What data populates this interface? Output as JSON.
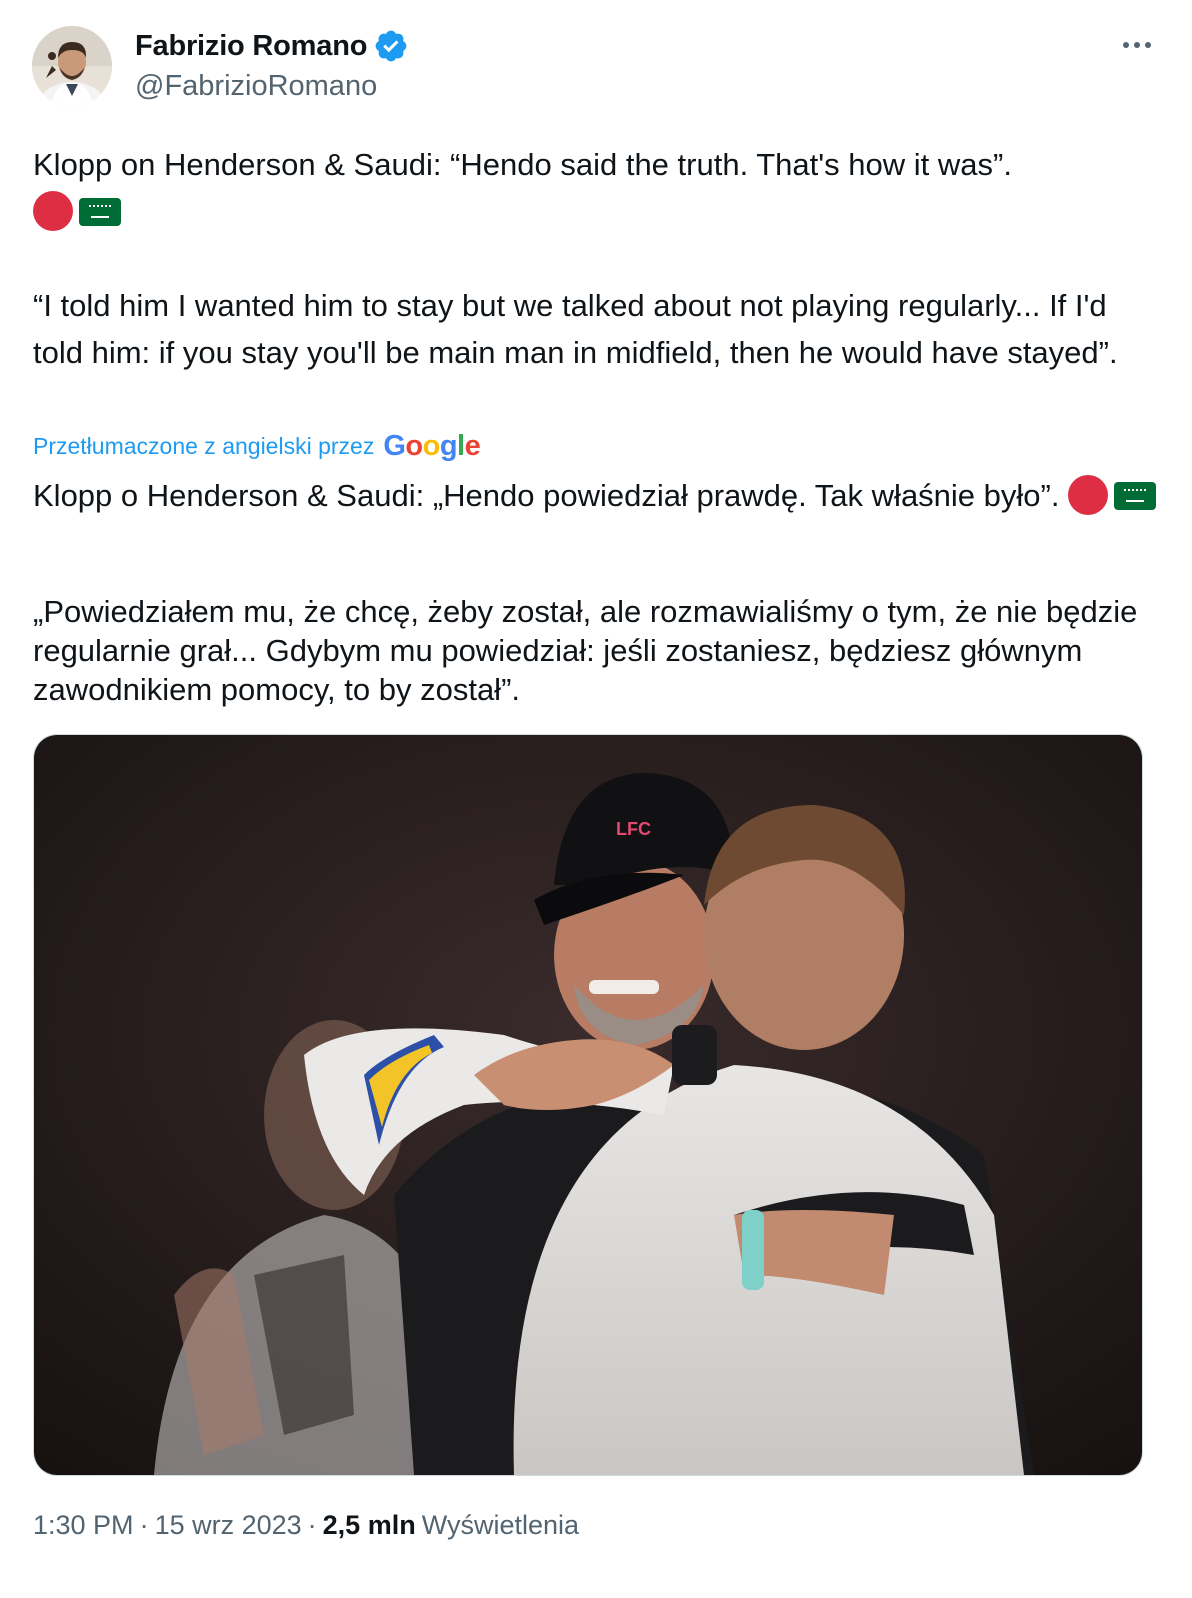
{
  "author": {
    "name": "Fabrizio Romano",
    "handle": "@FabrizioRomano",
    "verified": true,
    "verified_color": "#1d9bf0"
  },
  "menu": {
    "icon": "more-options-icon"
  },
  "tweet": {
    "original_line1": "Klopp on Henderson & Saudi: “Hendo said the truth. That's how it was”.",
    "original_line2": "“I told him I wanted him to stay but we talked about not playing regularly... If I'd told him: if you stay you'll be main man in midfield, then he would have stayed”.",
    "emojis": [
      "red-circle-emoji",
      "saudi-arabia-flag-emoji"
    ]
  },
  "translation": {
    "label": "Przetłumaczone z angielski przez",
    "provider": "Google",
    "line1": "Klopp o Henderson & Saudi: „Hendo powiedział prawdę. Tak właśnie było”.",
    "line2": "„Powiedziałem mu, że chcę, żeby został, ale rozmawialiśmy o tym, że nie będzie regularnie grał... Gdybym mu powiedział: jeśli zostaniesz, będziesz głównym zawodnikiem pomocy, to by został”."
  },
  "media": {
    "type": "photo",
    "cap_badge": "LFC"
  },
  "footer": {
    "time": "1:30 PM",
    "separator": "·",
    "date": "15 wrz 2023",
    "views_count": "2,5 mln",
    "views_label": "Wyświetlenia"
  },
  "colors": {
    "text": "#0f1419",
    "secondary": "#536471",
    "link": "#1d9bf0",
    "border": "#cfd9de"
  }
}
